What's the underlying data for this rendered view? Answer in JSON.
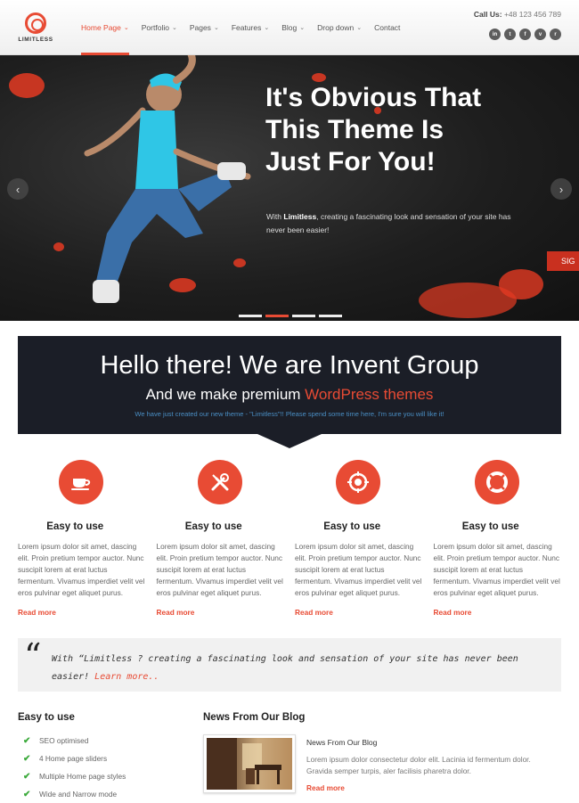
{
  "colors": {
    "accent": "#e84b34",
    "dark_banner": "#1b1e27",
    "check": "#3caa3c",
    "note_blue": "#4a8fc5"
  },
  "header": {
    "logo_text": "LIMITLESS",
    "nav": [
      {
        "label": "Home Page",
        "active": true
      },
      {
        "label": "Portfolio"
      },
      {
        "label": "Pages"
      },
      {
        "label": "Features"
      },
      {
        "label": "Blog"
      },
      {
        "label": "Drop down"
      },
      {
        "label": "Contact"
      }
    ],
    "call_label": "Call Us:",
    "call_number": "+48 123 456 789",
    "socials": [
      {
        "icon": "linkedin-icon",
        "glyph": "in"
      },
      {
        "icon": "twitter-icon",
        "glyph": "t"
      },
      {
        "icon": "facebook-icon",
        "glyph": "f"
      },
      {
        "icon": "vimeo-icon",
        "glyph": "v"
      },
      {
        "icon": "rss-icon",
        "glyph": "r"
      }
    ]
  },
  "hero": {
    "heading_line1": "It's Obvious That",
    "heading_line2": "This Theme Is",
    "heading_line3": "Just For You!",
    "text_prefix": "With ",
    "text_brand": "Limitless",
    "text_suffix": ", creating a fascinating look and sensation of your site has never been easier!",
    "prev_glyph": "‹",
    "next_glyph": "›",
    "side_tab": "SIG",
    "slide_count": 4,
    "active_slide": 2
  },
  "intro": {
    "title": "Hello there! We are Invent Group",
    "sub_prefix": "And we make premium ",
    "sub_accent": "WordPress themes",
    "note": "We have just created our new theme - \"Limitless\"!! Please spend some time here, I'm sure you will like it!"
  },
  "features": [
    {
      "icon": "coffee-cup-icon",
      "title": "Easy to use",
      "text": "Lorem ipsum dolor sit amet, dascing elit. Proin pretium tempor auctor. Nunc suscipit lorem at erat luctus fermentum. Vivamus imperdiet velit vel eros pulvinar eget aliquet purus.",
      "more": "Read more"
    },
    {
      "icon": "tools-icon",
      "title": "Easy to use",
      "text": "Lorem ipsum dolor sit amet, dascing elit. Proin pretium tempor auctor. Nunc suscipit lorem at erat luctus fermentum. Vivamus imperdiet velit vel eros pulvinar eget aliquet purus.",
      "more": "Read more"
    },
    {
      "icon": "target-icon",
      "title": "Easy to use",
      "text": "Lorem ipsum dolor sit amet, dascing elit. Proin pretium tempor auctor. Nunc suscipit lorem at erat luctus fermentum. Vivamus imperdiet velit vel eros pulvinar eget aliquet purus.",
      "more": "Read more"
    },
    {
      "icon": "lifebuoy-icon",
      "title": "Easy to use",
      "text": "Lorem ipsum dolor sit amet, dascing elit. Proin pretium tempor auctor. Nunc suscipit lorem at erat luctus fermentum. Vivamus imperdiet velit vel eros pulvinar eget aliquet purus.",
      "more": "Read more"
    }
  ],
  "quote": {
    "mark": "“",
    "text": "With “Limitless    ? creating a fascinating look and sensation of your site has never been easier! ",
    "link": "Learn more.."
  },
  "checklist": {
    "title": "Easy to use",
    "check_glyph": "✔",
    "items": [
      "SEO optimised",
      "4 Home page sliders",
      "Multiple Home page styles",
      "Wide and Narrow mode"
    ]
  },
  "blog": {
    "title": "News From Our Blog",
    "post_title": "News From Our Blog",
    "excerpt": "Lorem ipsum dolor consectetur dolor elit. Lacinia id fermentum dolor. Gravida semper turpis, aler facilisis pharetra dolor.",
    "more": "Read more"
  }
}
